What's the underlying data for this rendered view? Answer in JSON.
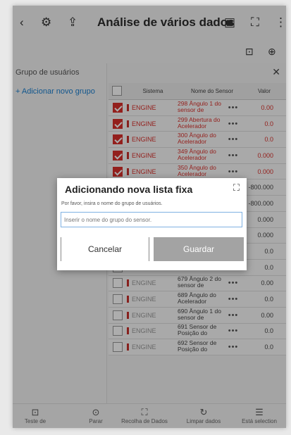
{
  "header": {
    "title": "Análise de vários dados"
  },
  "groups": {
    "title": "Grupo de usuários",
    "add_label": "+ Adicionar novo grupo"
  },
  "table": {
    "headers": [
      "Sistema",
      "Nome do Sensor",
      "Valor"
    ],
    "rows": [
      {
        "system": "ENGINE",
        "sensor": "298 Ângulo 1 do sensor de",
        "value": "0.00",
        "checked": true
      },
      {
        "system": "ENGINE",
        "sensor": "299 Abertura do Acelerador",
        "value": "0.0",
        "checked": true
      },
      {
        "system": "ENGINE",
        "sensor": "300 Ângulo do Acelerador",
        "value": "0.0",
        "checked": true
      },
      {
        "system": "ENGINE",
        "sensor": "349 Ângulo do Acelerador",
        "value": "0.000",
        "checked": true
      },
      {
        "system": "ENGINE",
        "sensor": "350 Ângulo do Acelerador",
        "value": "0.000",
        "checked": true
      },
      {
        "system": "",
        "sensor": "",
        "value": "-800.000",
        "checked": false
      },
      {
        "system": "",
        "sensor": "",
        "value": "-800.000",
        "checked": false
      },
      {
        "system": "",
        "sensor": "",
        "value": "0.000",
        "checked": false
      },
      {
        "system": "",
        "sensor": "",
        "value": "0.000",
        "checked": false
      },
      {
        "system": "",
        "sensor": "",
        "value": "0.0",
        "checked": false
      },
      {
        "system": "",
        "sensor": "",
        "value": "0.0",
        "checked": false
      },
      {
        "system": "ENGINE",
        "sensor": "679 Ângulo 2 do sensor de",
        "value": "0.00",
        "checked": false
      },
      {
        "system": "ENGINE",
        "sensor": "689 Ângulo do Acelerador",
        "value": "0.0",
        "checked": false
      },
      {
        "system": "ENGINE",
        "sensor": "690 Ângulo 1 do sensor de",
        "value": "0.00",
        "checked": false
      },
      {
        "system": "ENGINE",
        "sensor": "691 Sensor de Posição do",
        "value": "0.0",
        "checked": false
      },
      {
        "system": "ENGINE",
        "sensor": "692 Sensor de Posição do",
        "value": "0.0",
        "checked": false
      }
    ]
  },
  "bottom": {
    "items": [
      "Teste de",
      "Parar",
      "Recolha de Dados",
      "Limpar dados",
      "Está selection"
    ]
  },
  "modal": {
    "title": "Adicionando nova lista fixa",
    "subtitle": "Por favor, insira o nome do grupo de usuários.",
    "placeholder": "Inserir o nome do grupo do sensor.",
    "cancel_label": "Cancelar",
    "save_label": "Guardar"
  },
  "colors": {
    "accent": "#d9302b",
    "link": "#1a7fd0",
    "save_bg": "#a3a3a3"
  },
  "icons": {
    "back": "chevron-left-icon",
    "settings": "gear-icon",
    "export": "export-icon",
    "vehicle": "vehicle-icon",
    "fullscreen": "fullscreen-icon",
    "more": "more-vertical-icon"
  }
}
